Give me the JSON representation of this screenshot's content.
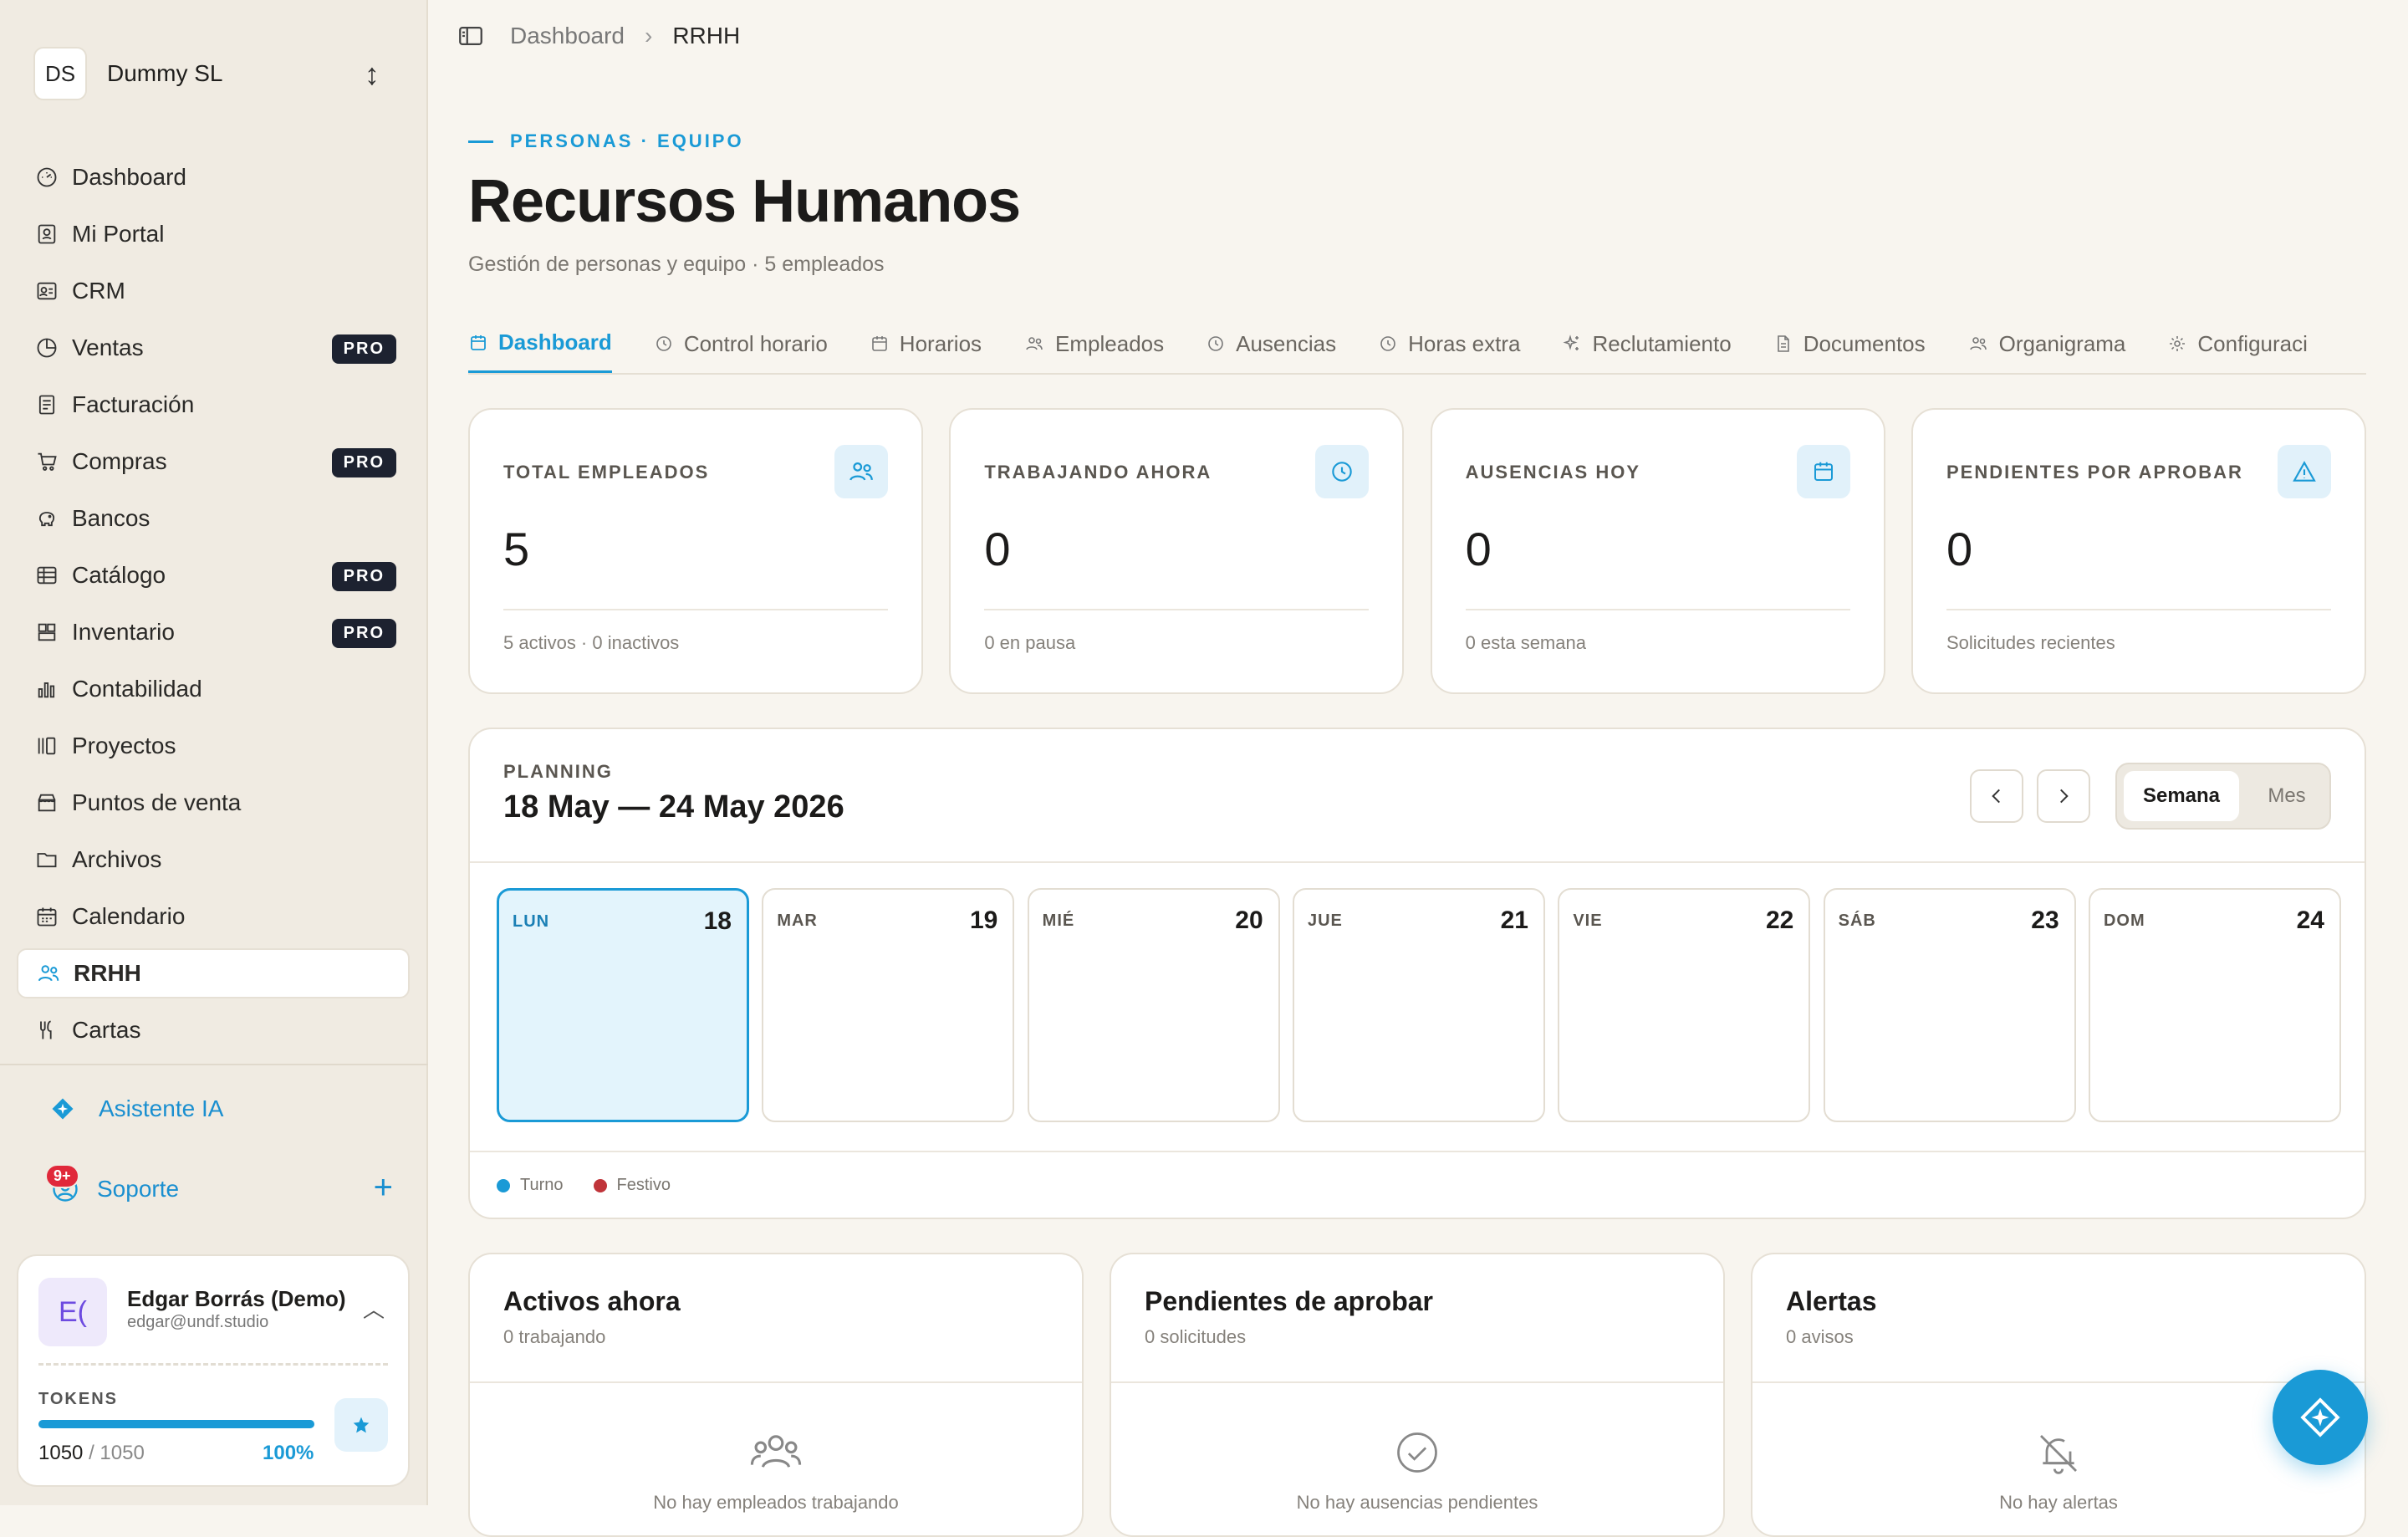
{
  "company": {
    "initials": "DS",
    "name": "Dummy SL"
  },
  "nav": [
    {
      "label": "Dashboard",
      "icon": "dashboard-icon",
      "pro": ""
    },
    {
      "label": "Mi Portal",
      "icon": "portal-icon",
      "pro": ""
    },
    {
      "label": "CRM",
      "icon": "crm-icon",
      "pro": ""
    },
    {
      "label": "Ventas",
      "icon": "sales-icon",
      "pro": "PRO"
    },
    {
      "label": "Facturación",
      "icon": "invoice-icon",
      "pro": ""
    },
    {
      "label": "Compras",
      "icon": "cart-icon",
      "pro": "PRO"
    },
    {
      "label": "Bancos",
      "icon": "bank-icon",
      "pro": ""
    },
    {
      "label": "Catálogo",
      "icon": "catalog-icon",
      "pro": "PRO"
    },
    {
      "label": "Inventario",
      "icon": "inventory-icon",
      "pro": "PRO"
    },
    {
      "label": "Contabilidad",
      "icon": "accounting-icon",
      "pro": ""
    },
    {
      "label": "Proyectos",
      "icon": "projects-icon",
      "pro": ""
    },
    {
      "label": "Puntos de venta",
      "icon": "pos-icon",
      "pro": ""
    },
    {
      "label": "Archivos",
      "icon": "folder-icon",
      "pro": ""
    },
    {
      "label": "Calendario",
      "icon": "calendar-icon",
      "pro": ""
    },
    {
      "label": "RRHH",
      "icon": "users-icon",
      "pro": ""
    },
    {
      "label": "Cartas",
      "icon": "utensils-icon",
      "pro": ""
    }
  ],
  "assistant": {
    "label": "Asistente IA"
  },
  "support": {
    "label": "Soporte",
    "badge": "9+"
  },
  "user": {
    "initials": "E(",
    "name": "Edgar Borrás (Demo)",
    "email": "edgar@undf.studio"
  },
  "tokens": {
    "label": "TOKENS",
    "used": "1050",
    "total": "/ 1050",
    "percent": "100%",
    "fraction": 1.0
  },
  "breadcrumb": {
    "parent": "Dashboard",
    "current": "RRHH"
  },
  "header": {
    "kicker": "PERSONAS · EQUIPO",
    "title": "Recursos Humanos",
    "subtitle": "Gestión de personas y equipo · 5 empleados"
  },
  "tabs": [
    {
      "label": "Dashboard"
    },
    {
      "label": "Control horario"
    },
    {
      "label": "Horarios"
    },
    {
      "label": "Empleados"
    },
    {
      "label": "Ausencias"
    },
    {
      "label": "Horas extra"
    },
    {
      "label": "Reclutamiento"
    },
    {
      "label": "Documentos"
    },
    {
      "label": "Organigrama"
    },
    {
      "label": "Configuraci"
    }
  ],
  "stats": [
    {
      "label": "TOTAL EMPLEADOS",
      "value": "5",
      "note": "5 activos · 0 inactivos"
    },
    {
      "label": "TRABAJANDO AHORA",
      "value": "0",
      "note": "0 en pausa"
    },
    {
      "label": "AUSENCIAS HOY",
      "value": "0",
      "note": "0 esta semana"
    },
    {
      "label": "PENDIENTES POR APROBAR",
      "value": "0",
      "note": "Solicitudes recientes"
    }
  ],
  "planning": {
    "label": "PLANNING",
    "range": "18 May — 24 May 2026",
    "view_week": "Semana",
    "view_month": "Mes",
    "days": [
      {
        "name": "LUN",
        "num": "18"
      },
      {
        "name": "MAR",
        "num": "19"
      },
      {
        "name": "MIÉ",
        "num": "20"
      },
      {
        "name": "JUE",
        "num": "21"
      },
      {
        "name": "VIE",
        "num": "22"
      },
      {
        "name": "SÁB",
        "num": "23"
      },
      {
        "name": "DOM",
        "num": "24"
      }
    ],
    "legend": [
      {
        "label": "Turno",
        "color": "#1a9ad6"
      },
      {
        "label": "Festivo",
        "color": "#c0343a"
      }
    ]
  },
  "cards": [
    {
      "title": "Activos ahora",
      "sub": "0 trabajando",
      "empty": "No hay empleados trabajando"
    },
    {
      "title": "Pendientes de aprobar",
      "sub": "0 solicitudes",
      "empty": "No hay ausencias pendientes"
    },
    {
      "title": "Alertas",
      "sub": "0 avisos",
      "empty": "No hay alertas"
    }
  ],
  "colors": {
    "accent": "#1a9ad6",
    "pro_badge": "#1d2230",
    "badge": "#e0283a"
  }
}
